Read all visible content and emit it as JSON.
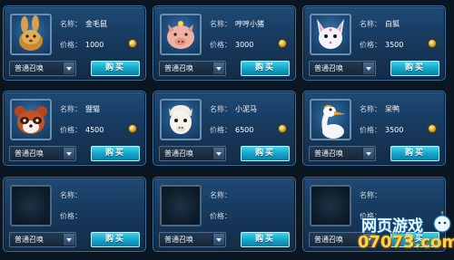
{
  "labels": {
    "name_key": "名称：",
    "price_key": "价格："
  },
  "cards": [
    {
      "pet": "squirrel-portrait",
      "name": "金毛鼠",
      "price": "1000",
      "summon": "普通召唤",
      "buy": "购买"
    },
    {
      "pet": "pig-portrait",
      "name": "哼哼小猪",
      "price": "3000",
      "summon": "普通召唤",
      "buy": "购买"
    },
    {
      "pet": "fox-portrait",
      "name": "白狐",
      "price": "3500",
      "summon": "普通召唤",
      "buy": "购买"
    },
    {
      "pet": "raccoon-portrait",
      "name": "狸猫",
      "price": "4500",
      "summon": "普通召唤",
      "buy": "购买"
    },
    {
      "pet": "alpaca-portrait",
      "name": "小泥马",
      "price": "6500",
      "summon": "普通召唤",
      "buy": "购买"
    },
    {
      "pet": "goose-portrait",
      "name": "呆鸭",
      "price": "3500",
      "summon": "普通召唤",
      "buy": "购买"
    },
    {
      "pet": "empty-slot",
      "name": "",
      "price": "",
      "summon": "普通召唤",
      "buy": "购买"
    },
    {
      "pet": "empty-slot",
      "name": "",
      "price": "",
      "summon": "普通召唤",
      "buy": "购买"
    },
    {
      "pet": "empty-slot",
      "name": "",
      "price": "",
      "summon": "普通召唤",
      "buy": "购买"
    }
  ],
  "watermark": {
    "line1": "网页游戏",
    "line2": "07073.com"
  },
  "colors": {
    "panel": "#1f4a75",
    "buy_button": "#15a7c9",
    "coin": "#e1b23a",
    "background": "#0a1622"
  }
}
